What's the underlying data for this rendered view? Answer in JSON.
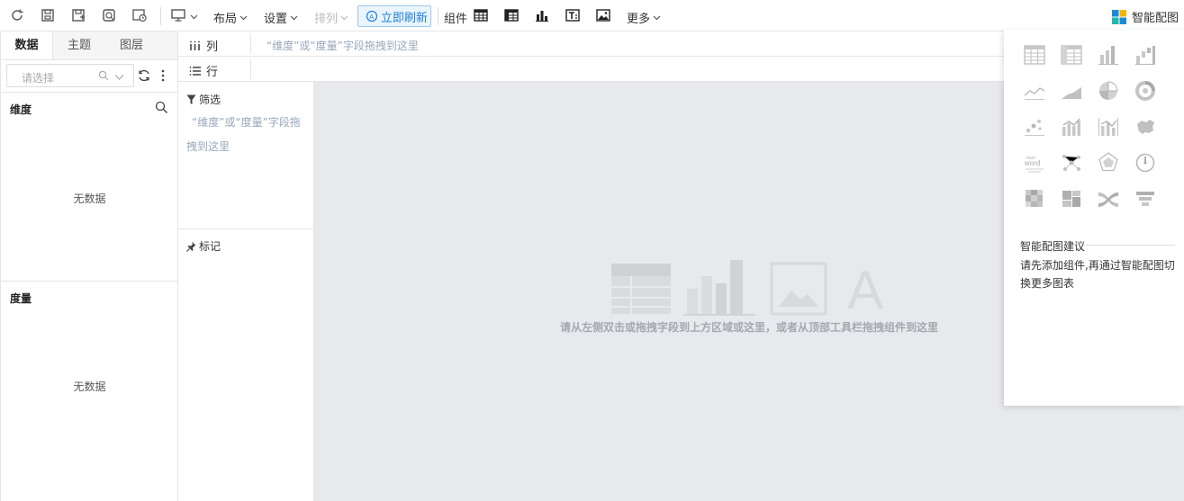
{
  "toolbar": {
    "layout_label": "布局",
    "settings_label": "设置",
    "sort_label": "排列",
    "refresh_label": "立即刷新",
    "component_label": "组件",
    "more_label": "更多",
    "smart_chart_label": "智能配图",
    "accent_color": "#1d80d8"
  },
  "left_panel": {
    "tabs": [
      "数据",
      "主题",
      "图层"
    ],
    "search_placeholder": "请选择",
    "dimension_title": "维度",
    "dimension_empty": "无数据",
    "measure_title": "度量",
    "measure_empty": "无数据"
  },
  "shelves": {
    "column_label": "列",
    "row_label": "行",
    "column_hint": "“维度”或“度量”字段拖拽到这里"
  },
  "filter_mark": {
    "filter_title": "筛选",
    "filter_hint": "“维度”或“度量”字段拖拽到这里",
    "mark_title": "标记"
  },
  "canvas": {
    "hint": "请从左侧双击或拖拽字段到上方区域或这里，或者从顶部工具栏拖拽组件到这里",
    "background": "#e7e9ec"
  },
  "chart_panel": {
    "icons": [
      "table-icon",
      "cross-table-icon",
      "bar-chart-icon",
      "waterfall-chart-icon",
      "line-chart-icon",
      "area-chart-icon",
      "pie-chart-icon",
      "ring-chart-icon",
      "scatter-chart-icon",
      "bar-line-combo-icon",
      "dual-axis-icon",
      "map-icon",
      "word-cloud-icon",
      "network-icon",
      "radar-chart-icon",
      "gauge-icon",
      "heatmap-icon",
      "treemap-icon",
      "sankey-icon",
      "funnel-icon"
    ],
    "suggestion_title": "智能配图建议",
    "suggestion_text": "请先添加组件,再通过智能配图切换更多图表"
  }
}
